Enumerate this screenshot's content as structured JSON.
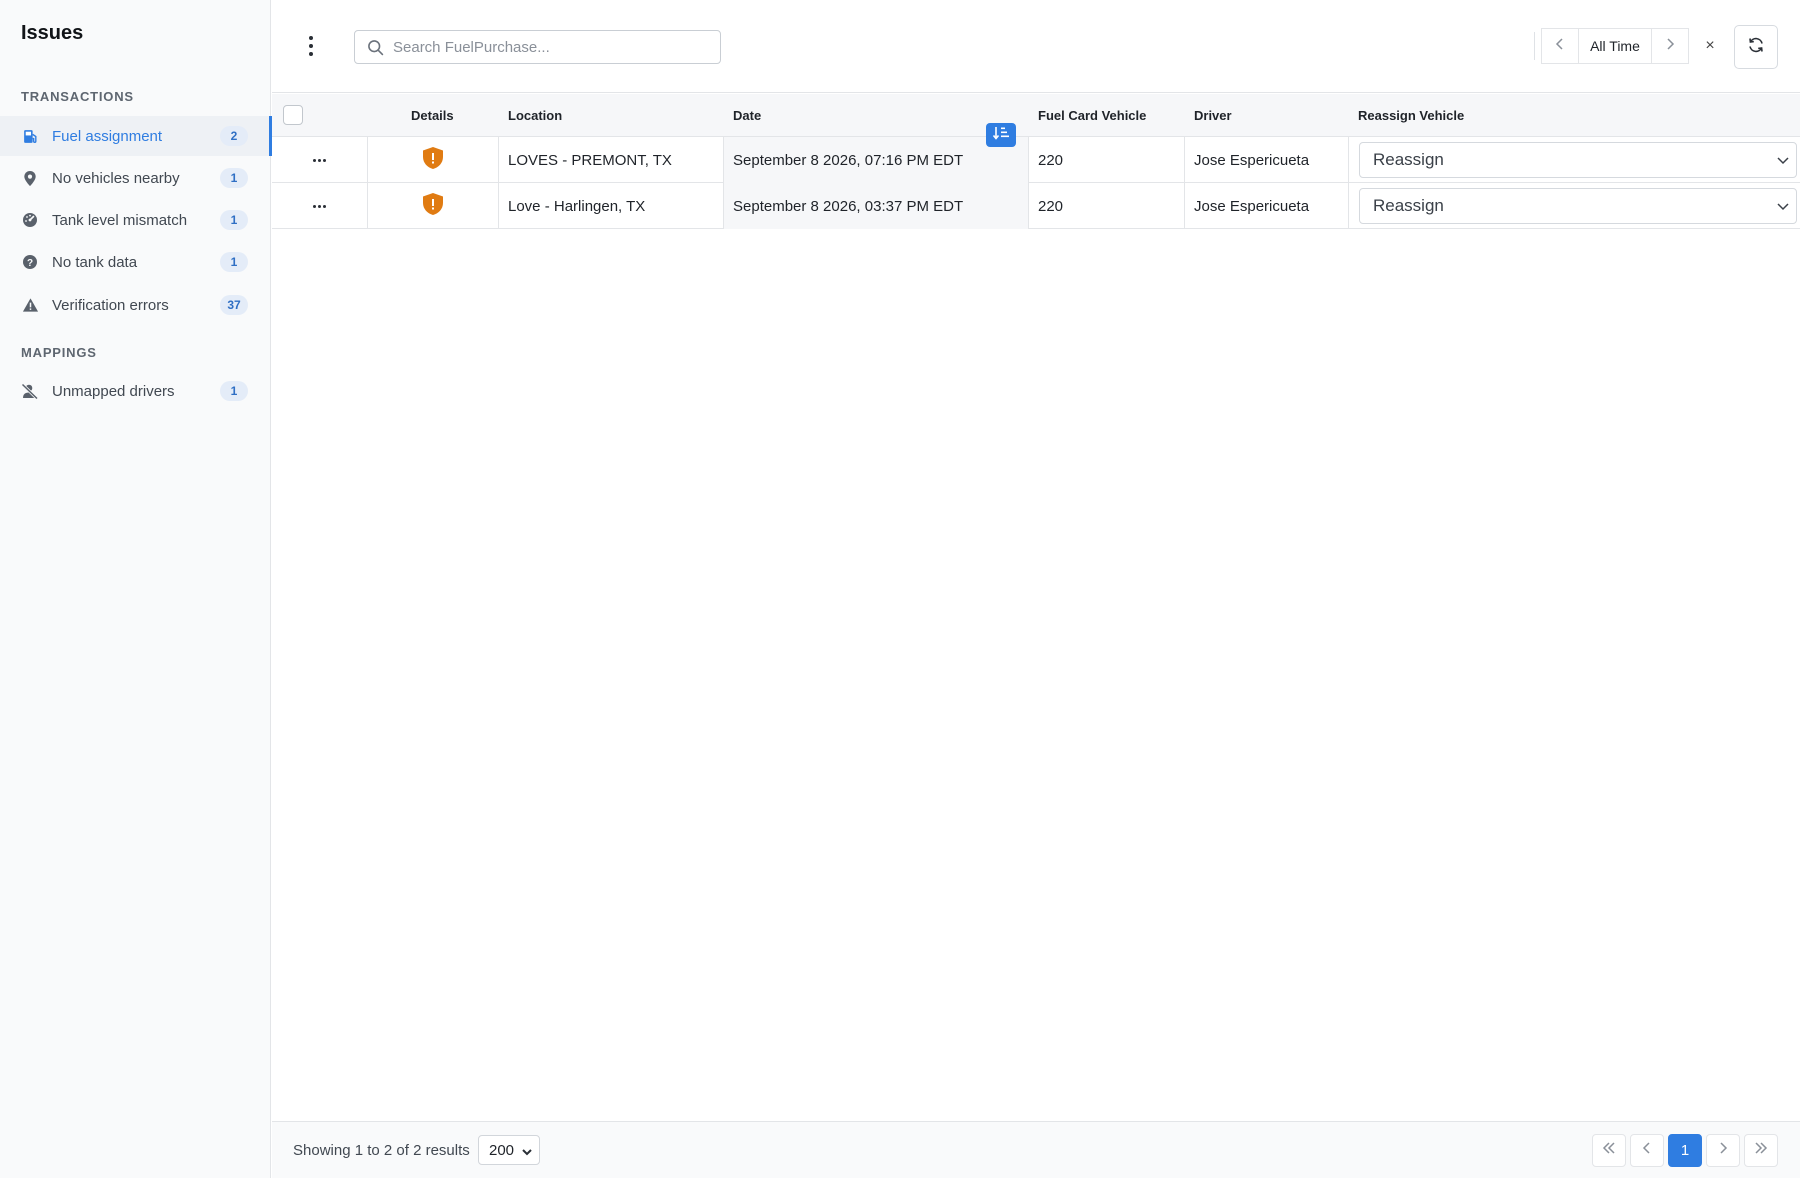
{
  "sidebar": {
    "title": "Issues",
    "sections": [
      {
        "heading": "TRANSACTIONS",
        "items": [
          {
            "label": "Fuel assignment",
            "count": "2",
            "icon": "fuel-pump-icon"
          },
          {
            "label": "No vehicles nearby",
            "count": "1",
            "icon": "map-pin-icon"
          },
          {
            "label": "Tank level mismatch",
            "count": "1",
            "icon": "gauge-icon"
          },
          {
            "label": "No tank data",
            "count": "1",
            "icon": "question-circle-icon"
          },
          {
            "label": "Verification errors",
            "count": "37",
            "icon": "warning-triangle-icon"
          }
        ]
      },
      {
        "heading": "MAPPINGS",
        "items": [
          {
            "label": "Unmapped drivers",
            "count": "1",
            "icon": "user-slash-icon"
          }
        ]
      }
    ],
    "active_item": "Fuel assignment"
  },
  "toolbar": {
    "search_placeholder": "Search FuelPurchase...",
    "date_range_label": "All Time",
    "clear_label": "×"
  },
  "table": {
    "columns": [
      "Details",
      "Location",
      "Date",
      "Fuel Card Vehicle",
      "Driver",
      "Reassign Vehicle"
    ],
    "rows": [
      {
        "location": "LOVES - PREMONT, TX",
        "date": "September 8 2026, 07:16 PM EDT",
        "vehicle": "220",
        "driver": "Jose Espericueta",
        "reassign": "Reassign"
      },
      {
        "location": "Love - Harlingen, TX",
        "date": "September 8 2026, 03:37 PM EDT",
        "vehicle": "220",
        "driver": "Jose Espericueta",
        "reassign": "Reassign"
      }
    ]
  },
  "footer": {
    "results_text": "Showing 1 to 2 of 2 results",
    "page_size": "200",
    "current_page": "1"
  },
  "colors": {
    "accent": "#2f7de1",
    "warning_shield": "#e07b12",
    "badge_bg": "#e4ecf8"
  }
}
